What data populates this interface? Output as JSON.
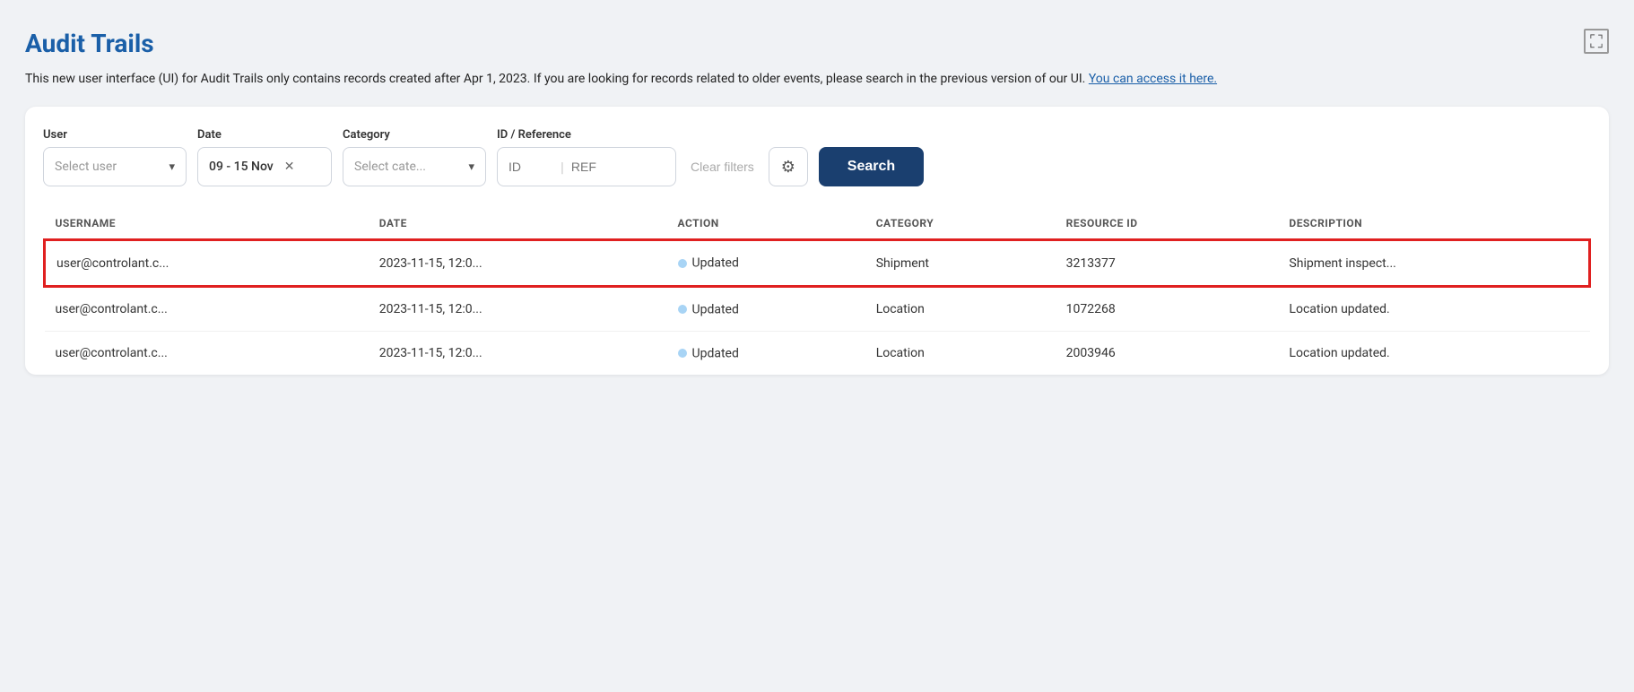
{
  "page": {
    "title": "Audit Trails",
    "expand_icon": "⛶",
    "notice": {
      "text": "This new user interface (UI) for Audit Trails only contains records created after Apr 1, 2023. If you are looking for records related to older events, please search in the previous version of our UI.",
      "link_text": "You can access it here."
    }
  },
  "filters": {
    "user_label": "User",
    "user_placeholder": "Select user",
    "date_label": "Date",
    "date_value": "09 - 15 Nov",
    "category_label": "Category",
    "category_placeholder": "Select cate...",
    "id_ref_label": "ID / Reference",
    "id_placeholder": "ID",
    "ref_placeholder": "REF",
    "clear_filters_label": "Clear filters",
    "search_label": "Search"
  },
  "table": {
    "columns": [
      {
        "id": "username",
        "label": "USERNAME"
      },
      {
        "id": "date",
        "label": "DATE"
      },
      {
        "id": "action",
        "label": "ACTION"
      },
      {
        "id": "category",
        "label": "CATEGORY"
      },
      {
        "id": "resource_id",
        "label": "RESOURCE ID"
      },
      {
        "id": "description",
        "label": "DESCRIPTION"
      }
    ],
    "rows": [
      {
        "highlighted": true,
        "username": "user@controlant.c...",
        "date": "2023-11-15, 12:0...",
        "action": "Updated",
        "category": "Shipment",
        "resource_id": "3213377",
        "description": "Shipment inspect..."
      },
      {
        "highlighted": false,
        "username": "user@controlant.c...",
        "date": "2023-11-15, 12:0...",
        "action": "Updated",
        "category": "Location",
        "resource_id": "1072268",
        "description": "Location updated."
      },
      {
        "highlighted": false,
        "username": "user@controlant.c...",
        "date": "2023-11-15, 12:0...",
        "action": "Updated",
        "category": "Location",
        "resource_id": "2003946",
        "description": "Location updated."
      }
    ]
  }
}
